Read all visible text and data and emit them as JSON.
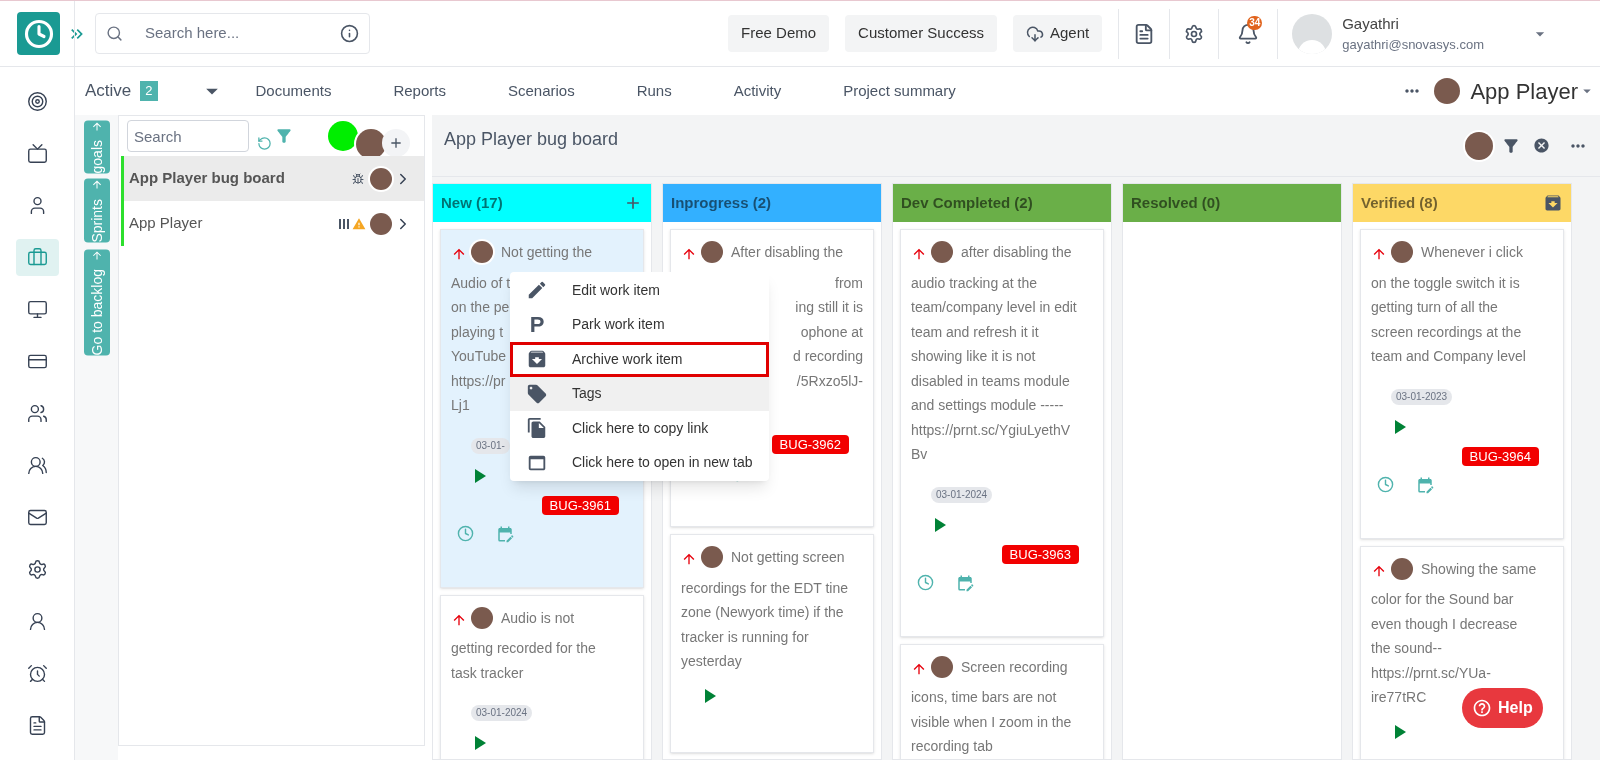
{
  "top_bar": {
    "search_placeholder": "Search here...",
    "buttons": [
      {
        "label": "Free Demo"
      },
      {
        "label": "Customer Success"
      },
      {
        "label": "Agent"
      }
    ],
    "notification_count": "34",
    "user": {
      "name": "Gayathri",
      "email": "gayathri@snovasys.com"
    }
  },
  "left_rail": [
    {
      "selected": false
    },
    {
      "selected": false
    },
    {
      "selected": false
    },
    {
      "selected": true
    },
    {
      "selected": false
    },
    {
      "selected": false
    },
    {
      "selected": false
    },
    {
      "selected": false
    },
    {
      "selected": false
    },
    {
      "selected": false
    },
    {
      "selected": false
    },
    {
      "selected": false
    },
    {
      "selected": false
    }
  ],
  "nav": {
    "status": "Active",
    "count": "2",
    "tabs": [
      {
        "label": "Documents",
        "selected": false
      },
      {
        "label": "Reports",
        "selected": false
      },
      {
        "label": "Scenarios",
        "selected": false
      },
      {
        "label": "Runs",
        "selected": false
      },
      {
        "label": "Activity",
        "selected": false
      },
      {
        "label": "Project summary",
        "selected": false
      }
    ],
    "project": "App Player"
  },
  "side_tabs": [
    "goals",
    "Sprints",
    "Go to backlog"
  ],
  "boards_panel": {
    "search_placeholder": "Search",
    "boards": [
      {
        "name": "App Player bug board",
        "selected": true
      },
      {
        "name": "App Player",
        "selected": false
      }
    ]
  },
  "board": {
    "title": "App Player bug board",
    "columns": [
      {
        "title": "New (17)",
        "color": "#00ffff",
        "cards": [
          {
            "selected": true,
            "fragments": [
              {
                "text": "Not getting the",
                "kind": "start"
              },
              {
                "text": "Audio of t",
                "kind": "start"
              },
              {
                "text": "on the pe",
                "kind": "start"
              },
              {
                "text": "playing t",
                "kind": "start"
              },
              {
                "text": "YouTube",
                "kind": "start"
              },
              {
                "text": "https://pr",
                "kind": "start"
              },
              {
                "text": "Lj1",
                "kind": "start"
              }
            ],
            "date": "03-01-",
            "tag": "BUG-3961"
          },
          {
            "selected": false,
            "lines": [
              "Audio is not",
              "getting recorded for the",
              "task tracker"
            ],
            "date": "03-01-2024"
          }
        ]
      },
      {
        "title": "Inprogress (2)",
        "color": "#33b0ff",
        "cards": [
          {
            "selected": false,
            "fragments": [
              {
                "text": "After disabling the",
                "kind": "start"
              },
              {
                "text": "from",
                "kind": "end"
              },
              {
                "text": "ing still it is",
                "kind": "end"
              },
              {
                "text": "ophone at",
                "kind": "end"
              },
              {
                "text": "d recording",
                "kind": "end"
              },
              {
                "text": "/5Rxzo5lJ-",
                "kind": "end"
              }
            ],
            "tag": "BUG-3962"
          },
          {
            "selected": false,
            "lines": [
              "Not getting screen",
              "recordings for the EDT tine",
              "zone (Newyork time) if the",
              "tracker is running for",
              "yesterday"
            ]
          }
        ]
      },
      {
        "title": "Dev Completed (2)",
        "color": "#6aaf48",
        "cards": [
          {
            "selected": false,
            "lines": [
              "after disabling the",
              "audio tracking at the",
              "team/company level in edit",
              "team and refresh it it",
              "showing like it is not",
              "disabled in teams module",
              "and settings module -----",
              "https://prnt.sc/YgiuLyethV",
              "Bv"
            ],
            "date": "03-01-2024",
            "tag": "BUG-3963"
          },
          {
            "selected": false,
            "lines": [
              "Screen recording",
              "icons, time bars are not",
              "visible when I zoom in the",
              "recording tab"
            ]
          }
        ]
      },
      {
        "title": "Resolved (0)",
        "color": "#6aaf48"
      },
      {
        "title": "Verified (8)",
        "color": "#fdd866",
        "cards": [
          {
            "selected": false,
            "lines": [
              "Whenever i click",
              "on the toggle switch it is",
              "getting turn of all the",
              "screen recordings at the",
              "team and Company level"
            ],
            "date": "03-01-2023",
            "tag": "BUG-3964"
          },
          {
            "selected": false,
            "lines": [
              "Showing the same",
              "color for the Sound bar",
              "even though I decrease",
              "the sound--",
              "https://prnt.sc/YUa-",
              "ire77tRC"
            ]
          }
        ]
      }
    ]
  },
  "context_menu": [
    {
      "label": "Edit work item",
      "hovered": false,
      "outlined": false
    },
    {
      "label": "Park work item",
      "glyph": "P",
      "hovered": false,
      "outlined": false
    },
    {
      "label": "Archive work item",
      "hovered": false,
      "outlined": true
    },
    {
      "label": "Tags",
      "hovered": true,
      "outlined": false
    },
    {
      "label": "Click here to copy link",
      "hovered": false,
      "outlined": false
    },
    {
      "label": "Click here to open in new tab",
      "hovered": false,
      "outlined": false
    }
  ],
  "help_button": "Help"
}
